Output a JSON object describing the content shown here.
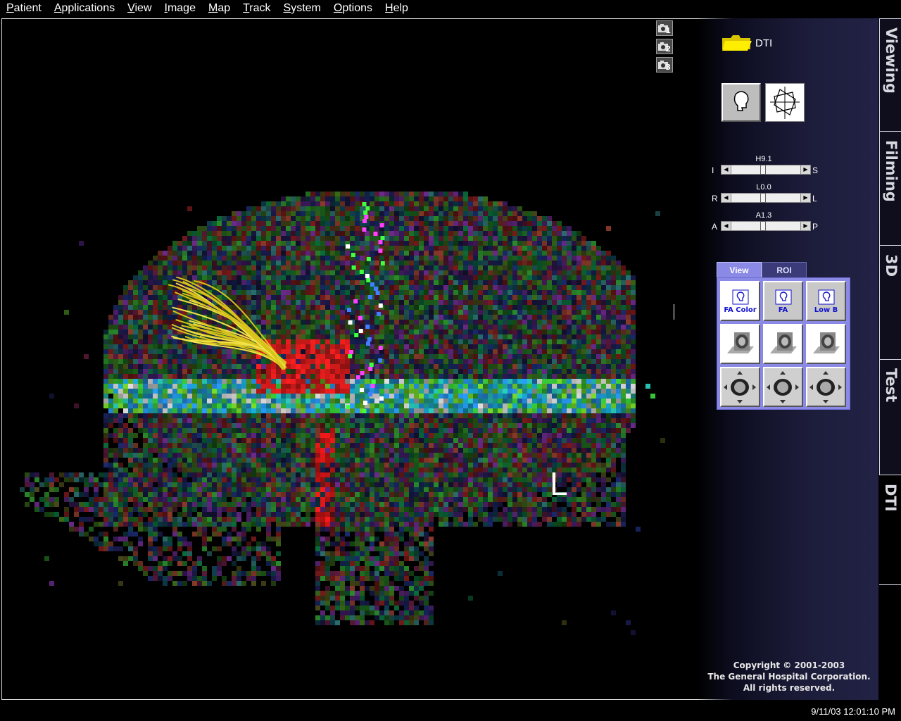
{
  "menu": [
    {
      "label": "Patient",
      "u": "P",
      "rest": "atient"
    },
    {
      "label": "Applications",
      "u": "A",
      "rest": "pplications"
    },
    {
      "label": "View",
      "u": "V",
      "rest": "iew"
    },
    {
      "label": "Image",
      "u": "I",
      "rest": "mage"
    },
    {
      "label": "Map",
      "u": "M",
      "rest": "ap"
    },
    {
      "label": "Track",
      "u": "T",
      "rest": "rack"
    },
    {
      "label": "System",
      "u": "S",
      "rest": "ystem"
    },
    {
      "label": "Options",
      "u": "O",
      "rest": "ptions"
    },
    {
      "label": "Help",
      "u": "H",
      "rest": "elp"
    }
  ],
  "camera_buttons": [
    "1",
    "2",
    "3"
  ],
  "series_folder": {
    "label": "DTI",
    "icon": "folder-icon"
  },
  "tools": {
    "head_icon": "head-icon",
    "reslice_icon": "reslice-icon"
  },
  "sliders": [
    {
      "value": "H9.1",
      "left": "I",
      "right": "S",
      "position": 0.45
    },
    {
      "value": "L0.0",
      "left": "R",
      "right": "L",
      "position": 0.45
    },
    {
      "value": "A1.3",
      "left": "A",
      "right": "P",
      "position": 0.45
    }
  ],
  "view_tabs": {
    "view": "View",
    "roi": "ROI"
  },
  "view_cells": [
    {
      "label": "FA Color",
      "icon": "head-icon"
    },
    {
      "label": "FA",
      "icon": "head-icon"
    },
    {
      "label": "Low B",
      "icon": "head-icon"
    },
    {
      "label": "",
      "icon": "sagittal-slice-icon"
    },
    {
      "label": "",
      "icon": "coronal-slice-icon"
    },
    {
      "label": "",
      "icon": "axial-slice-icon"
    },
    {
      "label": "",
      "icon": "sagittal-move-icon"
    },
    {
      "label": "",
      "icon": "coronal-move-icon"
    },
    {
      "label": "",
      "icon": "axial-move-icon"
    }
  ],
  "side_tabs": [
    {
      "label": "Viewing",
      "active": false
    },
    {
      "label": "Filming",
      "active": false
    },
    {
      "label": "3D",
      "active": false
    },
    {
      "label": "Test",
      "active": false
    },
    {
      "label": "DTI",
      "active": true
    }
  ],
  "orientation_label": "L",
  "copyright": {
    "line1": "Copyright © 2001-2003",
    "line2": "The General Hospital Corporation.",
    "line3": "All rights reserved."
  },
  "timestamp": "9/11/03 12:01:10 PM"
}
